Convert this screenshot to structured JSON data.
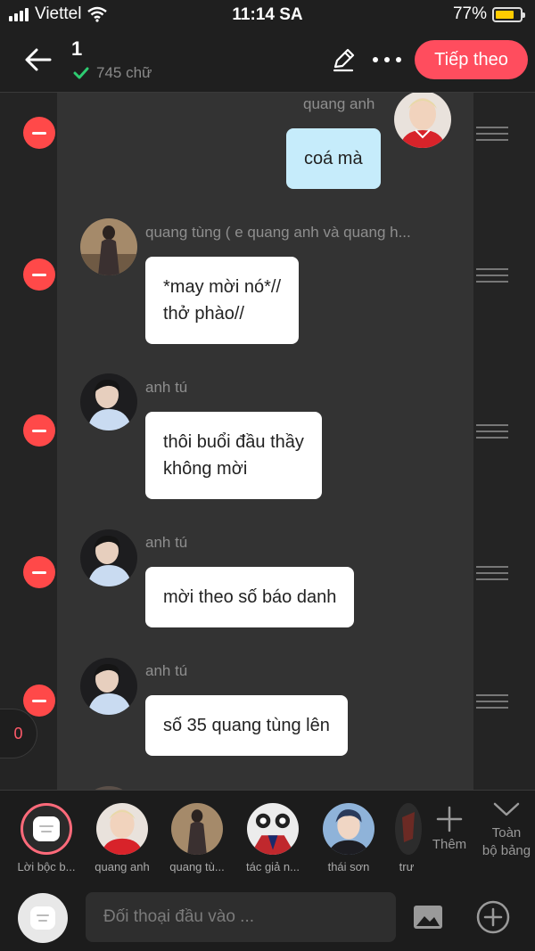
{
  "status_bar": {
    "carrier": "Viettel",
    "time": "11:14 SA",
    "battery": "77%",
    "battery_level": 0.77
  },
  "header": {
    "title": "1",
    "word_count": "745 chữ",
    "next_label": "Tiếp theo",
    "icons": [
      "back-arrow-icon",
      "pencil-icon",
      "more-dots-icon"
    ]
  },
  "messages": [
    {
      "sender": "quang anh",
      "text": "coá mà",
      "mine": true
    },
    {
      "sender": "quang tùng ( e quang anh và quang h...",
      "text": "*may mời nó*//\nthở phào//"
    },
    {
      "sender": "anh tú",
      "text": "thôi buổi đầu thầy\nkhông mời"
    },
    {
      "sender": "anh tú",
      "text": "mời theo số báo danh"
    },
    {
      "sender": "anh tú",
      "text": "số 35 quang tùng lên"
    }
  ],
  "counter": "0",
  "characters": [
    {
      "label": "Lời bộc b..."
    },
    {
      "label": "quang anh"
    },
    {
      "label": "quang tù..."
    },
    {
      "label": "tác giả n..."
    },
    {
      "label": "thái sơn"
    },
    {
      "label": "trư"
    }
  ],
  "more_label": "Thêm",
  "all_board_label": "Toàn\nbộ bảng",
  "input": {
    "placeholder": "Đối thoại đầu vào ..."
  },
  "colors": {
    "accent": "#ff4d5e",
    "delete": "#ff4949",
    "my_bubble": "#c6ecfb",
    "check": "#2ecc71"
  }
}
